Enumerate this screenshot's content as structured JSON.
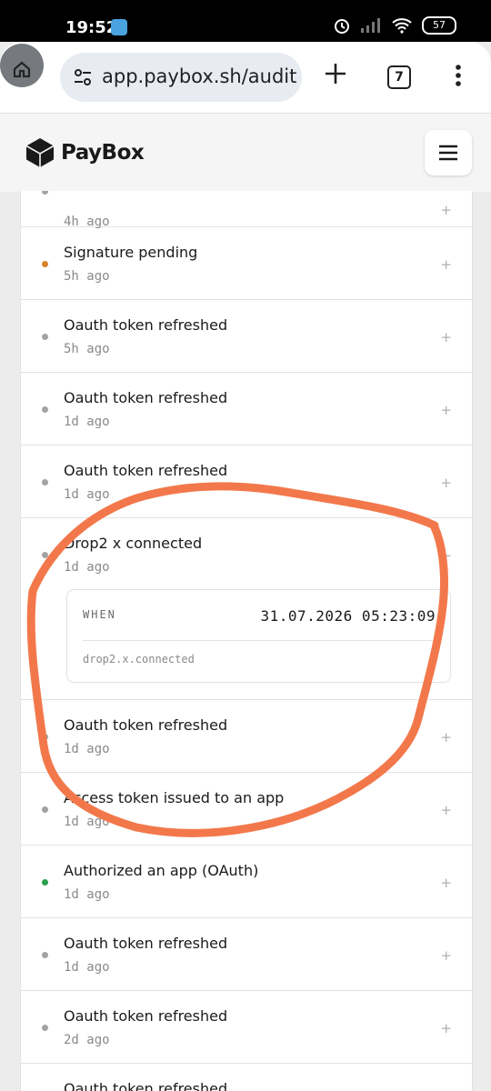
{
  "statusbar": {
    "time": "19:52",
    "battery": "57"
  },
  "browser": {
    "url": "app.paybox.sh/audit",
    "tab_count": "7"
  },
  "site": {
    "brand": "PayBox"
  },
  "colors": {
    "accent_pending": "#d9822b",
    "accent_success": "#2e9e4f",
    "annotation": "#f2784b"
  },
  "items": [
    {
      "title": "",
      "time": "4h ago"
    },
    {
      "title": "Signature pending",
      "time": "5h ago"
    },
    {
      "title": "Oauth token refreshed",
      "time": "5h ago"
    },
    {
      "title": "Oauth token refreshed",
      "time": "1d ago"
    },
    {
      "title": "Oauth token refreshed",
      "time": "1d ago"
    },
    {
      "title": "Drop2 x connected",
      "time": "1d ago"
    },
    {
      "title": "Oauth token refreshed",
      "time": "1d ago"
    },
    {
      "title": "Access token issued to an app",
      "time": "1d ago"
    },
    {
      "title": "Authorized an app (OAuth)",
      "time": "1d ago"
    },
    {
      "title": "Oauth token refreshed",
      "time": "1d ago"
    },
    {
      "title": "Oauth token refreshed",
      "time": "2d ago"
    },
    {
      "title": "Oauth token refreshed",
      "time": ""
    }
  ],
  "toggle": {
    "collapsed": "+",
    "expanded": "−"
  },
  "detail": {
    "label": "WHEN",
    "value": "31.07.2026 05:23:09",
    "event": "drop2.x.connected"
  }
}
